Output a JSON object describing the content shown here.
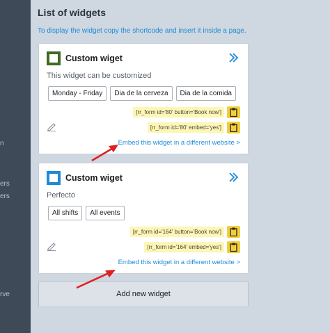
{
  "sidebar": {
    "fragments": [
      "n",
      "ers",
      "ers",
      "rve"
    ]
  },
  "page": {
    "title": "List of widgets",
    "subtitle": "To display the widget copy the shortcode and insert it inside a page."
  },
  "widgets": [
    {
      "icon": "square-icon",
      "icon_color": "#3e6b1f",
      "title": "Custom wiget",
      "description": "This widget can be customized",
      "tags": [
        "Monday - Friday",
        "Dia de la cerveza",
        "Dia de la comida"
      ],
      "shortcodes": [
        "[rr_form id='80' button='Book now']",
        "[rr_form id='80' embed='yes']"
      ],
      "embed_link": "Embed this widget in a different website >"
    },
    {
      "icon": "square-icon",
      "icon_color": "#1e8ad6",
      "title": "Custom wiget",
      "description": "Perfecto",
      "tags": [
        "All shifts",
        "All events"
      ],
      "shortcodes": [
        "[rr_form id='164' button='Book now']",
        "[rr_form id='164' embed='yes']"
      ],
      "embed_link": "Embed this widget in a different website >"
    }
  ],
  "add_button": "Add new widget",
  "colors": {
    "accent": "#1e8ad6",
    "annotation_arrow": "#e02020",
    "copy_button": "#f2cf3a",
    "shortcode_bg": "#fdf6b5"
  }
}
